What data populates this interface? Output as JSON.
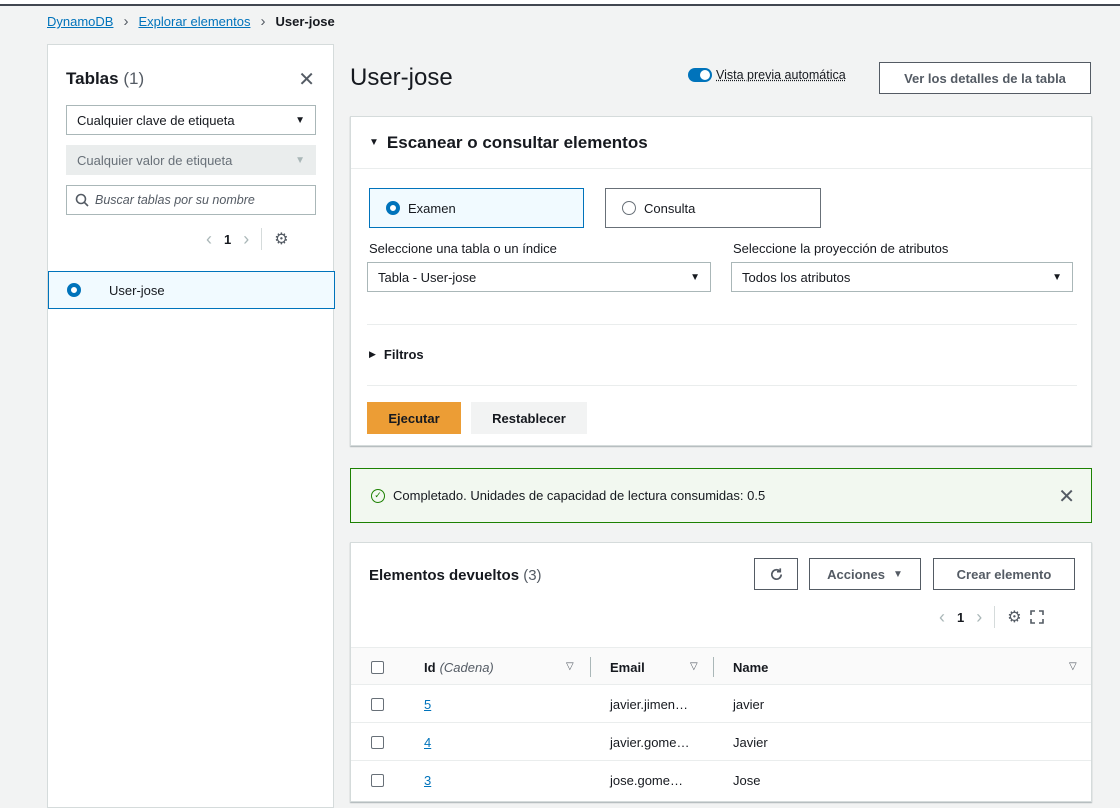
{
  "breadcrumb": {
    "items": [
      {
        "label": "DynamoDB"
      },
      {
        "label": "Explorar elementos"
      },
      {
        "label": "User-jose"
      }
    ]
  },
  "sidebar": {
    "title": "Tablas",
    "count": "(1)",
    "tag_key_select": "Cualquier clave de etiqueta",
    "tag_value_select": "Cualquier valor de etiqueta",
    "search_placeholder": "Buscar tablas por su nombre",
    "page": "1",
    "tables": [
      {
        "name": "User-jose",
        "selected": true
      }
    ]
  },
  "header": {
    "title": "User-jose",
    "auto_preview_label": "Vista previa automática",
    "auto_preview_on": true,
    "details_button": "Ver los detalles de la tabla"
  },
  "scan": {
    "title": "Escanear o consultar elementos",
    "modes": [
      {
        "label": "Examen",
        "selected": true
      },
      {
        "label": "Consulta",
        "selected": false
      }
    ],
    "table_index_label": "Seleccione una tabla o un índice",
    "table_index_value": "Tabla - User-jose",
    "projection_label": "Seleccione la proyección de atributos",
    "projection_value": "Todos los atributos",
    "filters_label": "Filtros",
    "run_button": "Ejecutar",
    "reset_button": "Restablecer"
  },
  "alert": {
    "message": "Completado. Unidades de capacidad de lectura consumidas: 0.5",
    "status_color": "#1d8102"
  },
  "items": {
    "title": "Elementos devueltos",
    "count": "(3)",
    "actions_button": "Acciones",
    "create_button": "Crear elemento",
    "page": "1",
    "columns": [
      {
        "label": "Id",
        "hint": "(Cadena)"
      },
      {
        "label": "Email"
      },
      {
        "label": "Name"
      }
    ],
    "rows": [
      {
        "id": "5",
        "email": "javier.jimen…",
        "name": "javier"
      },
      {
        "id": "4",
        "email": "javier.gome…",
        "name": "Javier"
      },
      {
        "id": "3",
        "email": "jose.gome…",
        "name": "Jose"
      }
    ]
  },
  "colors": {
    "accent": "#0073bb",
    "primary_button": "#ec9d35"
  }
}
